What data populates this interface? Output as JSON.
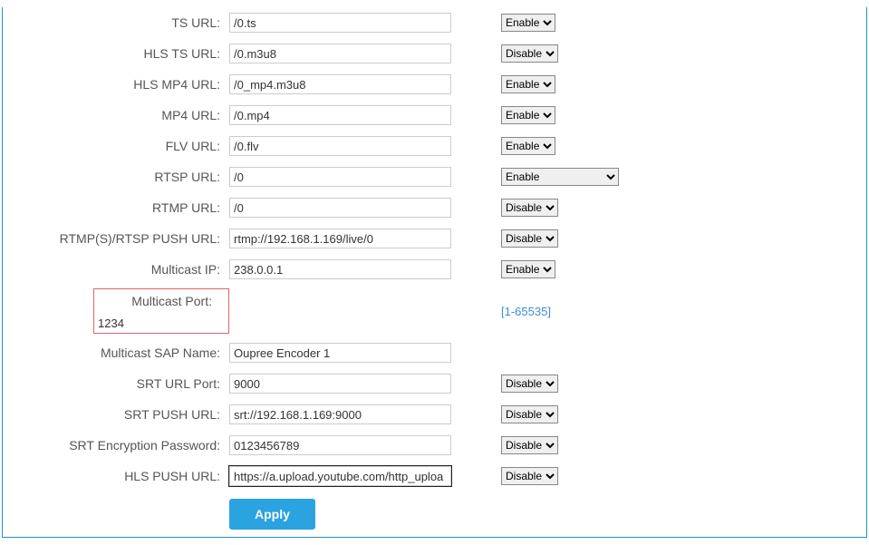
{
  "rows": {
    "ts_url": {
      "label": "TS URL:",
      "value": "/0.ts",
      "select": "Enable"
    },
    "hls_ts_url": {
      "label": "HLS TS URL:",
      "value": "/0.m3u8",
      "select": "Disable"
    },
    "hls_mp4_url": {
      "label": "HLS MP4 URL:",
      "value": "/0_mp4.m3u8",
      "select": "Enable"
    },
    "mp4_url": {
      "label": "MP4 URL:",
      "value": "/0.mp4",
      "select": "Enable"
    },
    "flv_url": {
      "label": "FLV URL:",
      "value": "/0.flv",
      "select": "Enable"
    },
    "rtsp_url": {
      "label": "RTSP URL:",
      "value": "/0",
      "select": "Enable",
      "wide": true
    },
    "rtmp_url": {
      "label": "RTMP URL:",
      "value": "/0",
      "select": "Disable"
    },
    "rtmp_push_url": {
      "label": "RTMP(S)/RTSP PUSH URL:",
      "value": "rtmp://192.168.1.169/live/0",
      "select": "Disable"
    },
    "multicast_ip": {
      "label": "Multicast IP:",
      "value": "238.0.0.1",
      "select": "Enable"
    },
    "multicast_port": {
      "label": "Multicast Port:",
      "value": "1234",
      "hint": "[1-65535]"
    },
    "multicast_sap": {
      "label": "Multicast SAP Name:",
      "value": "Oupree Encoder 1"
    },
    "srt_url_port": {
      "label": "SRT URL Port:",
      "value": "9000",
      "select": "Disable"
    },
    "srt_push_url": {
      "label": "SRT PUSH URL:",
      "value": "srt://192.168.1.169:9000",
      "select": "Disable"
    },
    "srt_enc_pwd": {
      "label": "SRT Encryption Password:",
      "value": "0123456789",
      "select": "Disable"
    },
    "hls_push_url": {
      "label": "HLS PUSH URL:",
      "value": "https://a.upload.youtube.com/http_uploa",
      "select": "Disable",
      "focused": true
    }
  },
  "apply_label": "Apply"
}
